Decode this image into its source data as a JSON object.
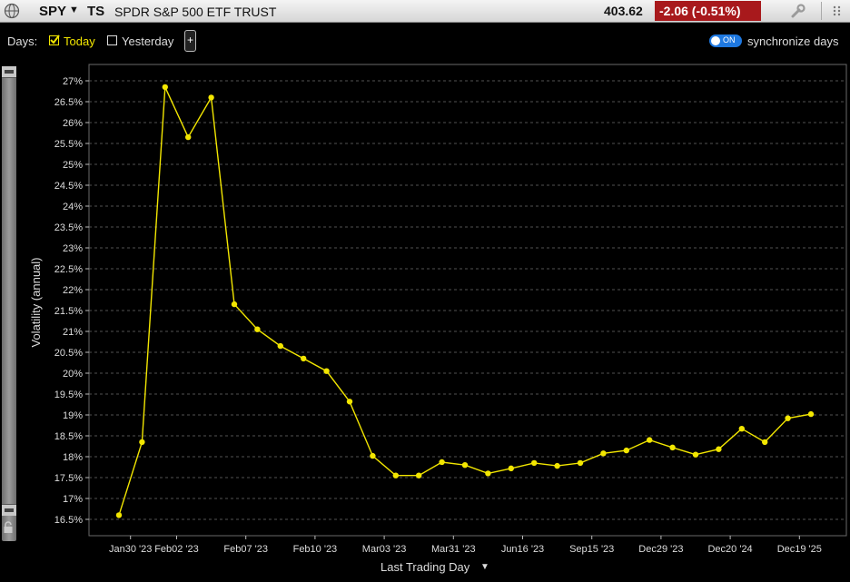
{
  "header": {
    "symbol": "SPY",
    "ts": "TS",
    "name": "SPDR S&P 500 ETF TRUST",
    "price": "403.62",
    "change": "-2.06  (-0.51%)",
    "change_color": "#a8191c"
  },
  "controls": {
    "days_label": "Days:",
    "today_label": "Today",
    "today_checked": true,
    "yesterday_label": "Yesterday",
    "yesterday_checked": false,
    "plus_label": "+",
    "toggle_text": "ON",
    "toggle_on": true,
    "sync_label": "synchronize days"
  },
  "icons": [
    "globe-icon",
    "chevron-down-icon",
    "wrench-icon",
    "lock-icon",
    "check-icon",
    "plus-icon"
  ],
  "chart_data": {
    "type": "line",
    "title": "",
    "xlabel": "Last Trading Day",
    "ylabel": "Volatility (annual)",
    "ylim": [
      16.5,
      27
    ],
    "yticks": [
      "16.5%",
      "17%",
      "17.5%",
      "18%",
      "18.5%",
      "19%",
      "19.5%",
      "20%",
      "20.5%",
      "21%",
      "21.5%",
      "22%",
      "22.5%",
      "23%",
      "23.5%",
      "24%",
      "24.5%",
      "25%",
      "25.5%",
      "26%",
      "26.5%",
      "27%"
    ],
    "xtick_labels": [
      "Jan30 '23",
      "Feb02 '23",
      "Feb07 '23",
      "Feb10 '23",
      "Mar03 '23",
      "Mar31 '23",
      "Jun16 '23",
      "Sep15 '23",
      "Dec29 '23",
      "Dec20 '24",
      "Dec19 '25"
    ],
    "grid": true,
    "line_color": "#f2e600",
    "series": [
      {
        "values": [
          16.6,
          18.35,
          26.85,
          25.65,
          26.6,
          21.65,
          21.05,
          20.65,
          20.35,
          20.05,
          19.32,
          18.02,
          17.55,
          17.55,
          17.87,
          17.8,
          17.6,
          17.72,
          17.85,
          17.78,
          17.85,
          18.08,
          18.15,
          18.4,
          18.22,
          18.05,
          18.18,
          18.67,
          18.35,
          18.92,
          19.02
        ]
      }
    ]
  }
}
